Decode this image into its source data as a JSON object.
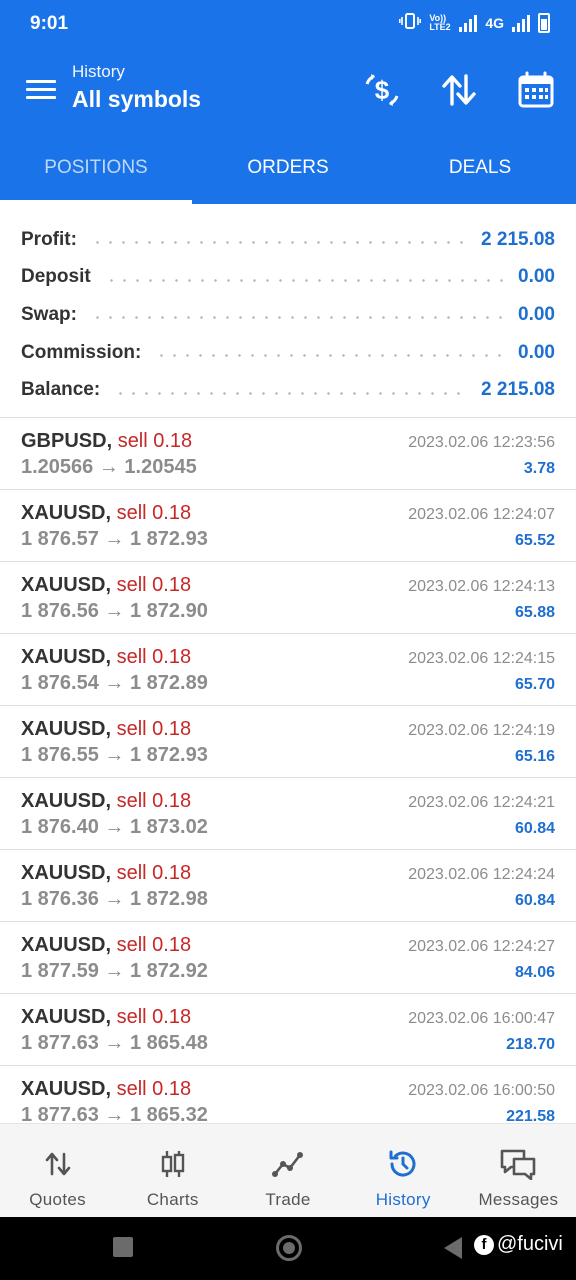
{
  "status": {
    "time": "9:01",
    "network": "4G",
    "volte": "Vo)) LTE2"
  },
  "appbar": {
    "subtitle": "History",
    "title": "All symbols"
  },
  "tabs": [
    {
      "label": "POSITIONS"
    },
    {
      "label": "ORDERS"
    },
    {
      "label": "DEALS"
    }
  ],
  "summary": [
    {
      "label": "Profit:",
      "value": "2 215.08"
    },
    {
      "label": "Deposit",
      "value": "0.00"
    },
    {
      "label": "Swap:",
      "value": "0.00"
    },
    {
      "label": "Commission:",
      "value": "0.00"
    },
    {
      "label": "Balance:",
      "value": "2 215.08"
    }
  ],
  "deals": [
    {
      "symbol": "GBPUSD,",
      "side": "sell 0.18",
      "prices": "1.20566 → 1.20545",
      "time": "2023.02.06 12:23:56",
      "profit": "3.78"
    },
    {
      "symbol": "XAUUSD,",
      "side": "sell 0.18",
      "prices": "1 876.57 → 1 872.93",
      "time": "2023.02.06 12:24:07",
      "profit": "65.52"
    },
    {
      "symbol": "XAUUSD,",
      "side": "sell 0.18",
      "prices": "1 876.56 → 1 872.90",
      "time": "2023.02.06 12:24:13",
      "profit": "65.88"
    },
    {
      "symbol": "XAUUSD,",
      "side": "sell 0.18",
      "prices": "1 876.54 → 1 872.89",
      "time": "2023.02.06 12:24:15",
      "profit": "65.70"
    },
    {
      "symbol": "XAUUSD,",
      "side": "sell 0.18",
      "prices": "1 876.55 → 1 872.93",
      "time": "2023.02.06 12:24:19",
      "profit": "65.16"
    },
    {
      "symbol": "XAUUSD,",
      "side": "sell 0.18",
      "prices": "1 876.40 → 1 873.02",
      "time": "2023.02.06 12:24:21",
      "profit": "60.84"
    },
    {
      "symbol": "XAUUSD,",
      "side": "sell 0.18",
      "prices": "1 876.36 → 1 872.98",
      "time": "2023.02.06 12:24:24",
      "profit": "60.84"
    },
    {
      "symbol": "XAUUSD,",
      "side": "sell 0.18",
      "prices": "1 877.59 → 1 872.92",
      "time": "2023.02.06 12:24:27",
      "profit": "84.06"
    },
    {
      "symbol": "XAUUSD,",
      "side": "sell 0.18",
      "prices": "1 877.63 → 1 865.48",
      "time": "2023.02.06 16:00:47",
      "profit": "218.70"
    },
    {
      "symbol": "XAUUSD,",
      "side": "sell 0.18",
      "prices": "1 877.63 → 1 865.32",
      "time": "2023.02.06 16:00:50",
      "profit": "221.58"
    }
  ],
  "bottomnav": [
    {
      "label": "Quotes",
      "icon": "quotes-arrows-icon"
    },
    {
      "label": "Charts",
      "icon": "candlestick-icon"
    },
    {
      "label": "Trade",
      "icon": "trade-line-icon"
    },
    {
      "label": "History",
      "icon": "history-clock-icon"
    },
    {
      "label": "Messages",
      "icon": "chat-bubbles-icon"
    }
  ],
  "watermark": "@fucivi",
  "colors": {
    "primary": "#1a73e8",
    "profit": "#1f6fd0",
    "sell": "#c62828",
    "muted": "#8c8c8c"
  }
}
